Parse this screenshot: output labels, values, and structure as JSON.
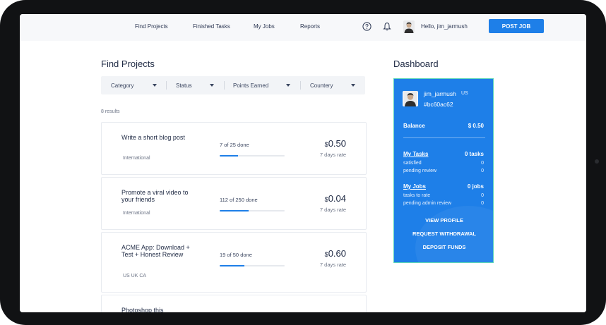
{
  "nav": {
    "links": [
      "Find Projects",
      "Finished Tasks",
      "My Jobs",
      "Reports"
    ],
    "hello": "Hello, jim_jarmush",
    "post_job": "POST JOB",
    "icons": [
      "help-circle-icon",
      "bell-icon"
    ]
  },
  "find": {
    "title": "Find Projects",
    "filters": [
      "Category",
      "Status",
      "Points Earned",
      "Countery"
    ],
    "results": "8 results"
  },
  "projects": [
    {
      "title": "Write a short blog post",
      "tags": "International",
      "progress": "7 of 25 done",
      "done": 7,
      "total": 25,
      "currency": "$",
      "price": "0.50",
      "rate": "7 days rate"
    },
    {
      "title": "Promote a viral video to your friends",
      "tags": "International",
      "progress": "112 of 250 done",
      "done": 112,
      "total": 250,
      "currency": "$",
      "price": "0.04",
      "rate": "7 days rate"
    },
    {
      "title": "ACME App: Download + Test + Honest Review",
      "tags": "US UK CA",
      "progress": "19 of 50 done",
      "done": 19,
      "total": 50,
      "currency": "$",
      "price": "0.60",
      "rate": "7 days rate"
    },
    {
      "title": "Photoshop this"
    }
  ],
  "dashboard": {
    "title": "Dashboard",
    "username": "jim_jarmush",
    "country": "US",
    "code": "#bc60ac62",
    "balance_label": "Balance",
    "balance_value": "$ 0.50",
    "my_tasks": {
      "label": "My Tasks",
      "value": "0 tasks",
      "rows": [
        {
          "label": "satisfied",
          "value": "0"
        },
        {
          "label": "pending review",
          "value": "0"
        }
      ]
    },
    "my_jobs": {
      "label": "My Jobs",
      "value": "0 jobs",
      "rows": [
        {
          "label": "tasks to rate",
          "value": "0"
        },
        {
          "label": "pending admin review",
          "value": "0"
        }
      ]
    },
    "actions": [
      "VIEW PROFILE",
      "REQUEST WITHDRAWAL",
      "DEPOSIT FUNDS"
    ]
  },
  "colors": {
    "accent": "#1e7fe8",
    "dashboard_border": "#5ed6b8",
    "text": "#1f2a44"
  }
}
